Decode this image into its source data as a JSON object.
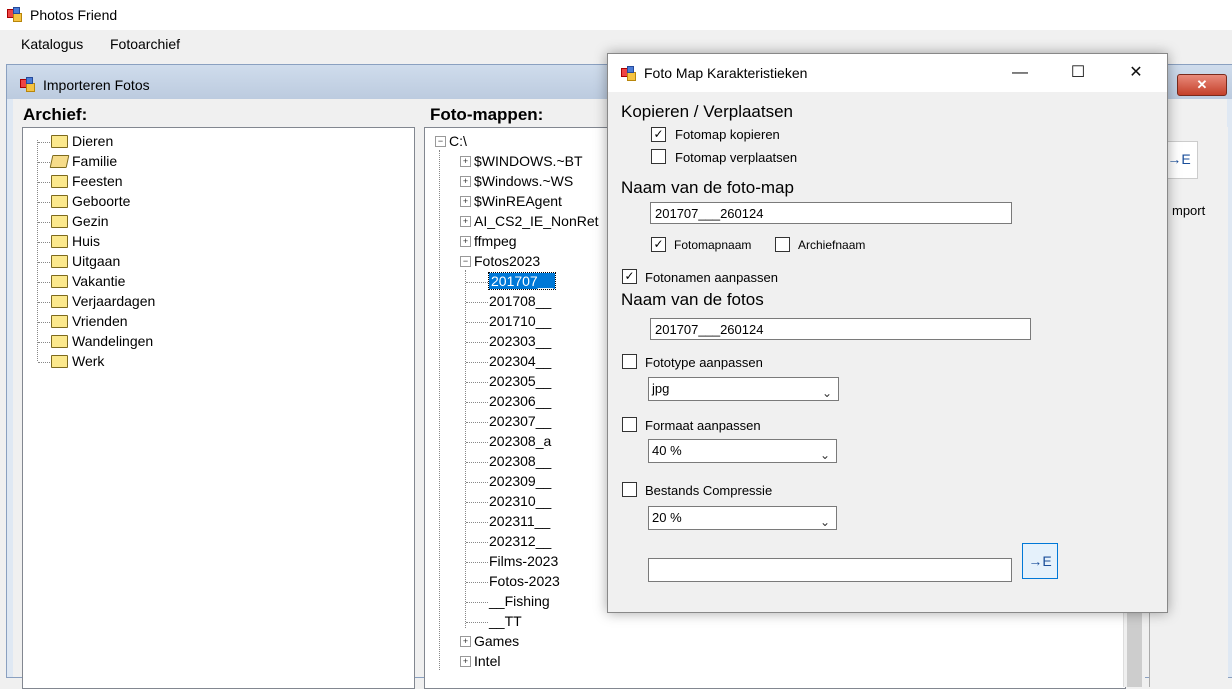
{
  "app": {
    "title": "Photos Friend"
  },
  "menu": [
    "Katalogus",
    "Fotoarchief"
  ],
  "child": {
    "title": "Importeren Fotos",
    "close_label": "✕",
    "import_label": "mport",
    "archief": {
      "heading": "Archief:",
      "items": [
        "Dieren",
        "Familie",
        "Feesten",
        "Geboorte",
        "Gezin",
        "Huis",
        "Uitgaan",
        "Vakantie",
        "Verjaardagen",
        "Vrienden",
        "Wandelingen",
        "Werk"
      ]
    },
    "fotomappen": {
      "heading": "Foto-mappen:",
      "root": "C:\\",
      "top_nodes": [
        "$WINDOWS.~BT",
        "$Windows.~WS",
        "$WinREAgent",
        "AI_CS2_IE_NonRet",
        "ffmpeg",
        "Fotos2023"
      ],
      "sub_nodes": [
        "201707__",
        "201708__",
        "201710__",
        "202303__",
        "202304__",
        "202305__",
        "202306__",
        "202307__",
        "202308_a",
        "202308__",
        "202309__",
        "202310__",
        "202311__",
        "202312__",
        "Films-2023",
        "Fotos-2023",
        "__Fishing",
        "__TT"
      ],
      "bottom_nodes": [
        "Games",
        "Intel"
      ],
      "selected": "201707__"
    }
  },
  "dialog": {
    "title": "Foto Map Karakteristieken",
    "minimize": "—",
    "maximize": "☐",
    "close": "✕",
    "kopieren_heading": "Kopieren / Verplaatsen",
    "kopieren_label": "Fotomap kopieren",
    "verplaatsen_label": "Fotomap verplaatsen",
    "naam_map_heading": "Naam van de foto-map",
    "naam_map_value": "201707___260124",
    "fotomapnaam_label": "Fotomapnaam",
    "archiefnaam_label": "Archiefnaam",
    "fotonamen_label": "Fotonamen aanpassen",
    "naam_fotos_heading": "Naam van de fotos",
    "naam_fotos_value": "201707___260124",
    "fototype_label": "Fototype aanpassen",
    "fototype_value": "jpg",
    "formaat_label": "Formaat aanpassen",
    "formaat_value": "40 %",
    "compressie_label": "Bestands Compressie",
    "compressie_value": "20 %",
    "path_value": "",
    "checks": {
      "kopieren": true,
      "verplaatsen": false,
      "fotomapnaam": true,
      "archiefnaam": false,
      "fotonamen": true,
      "fototype": false,
      "formaat": false,
      "compressie": false
    }
  }
}
